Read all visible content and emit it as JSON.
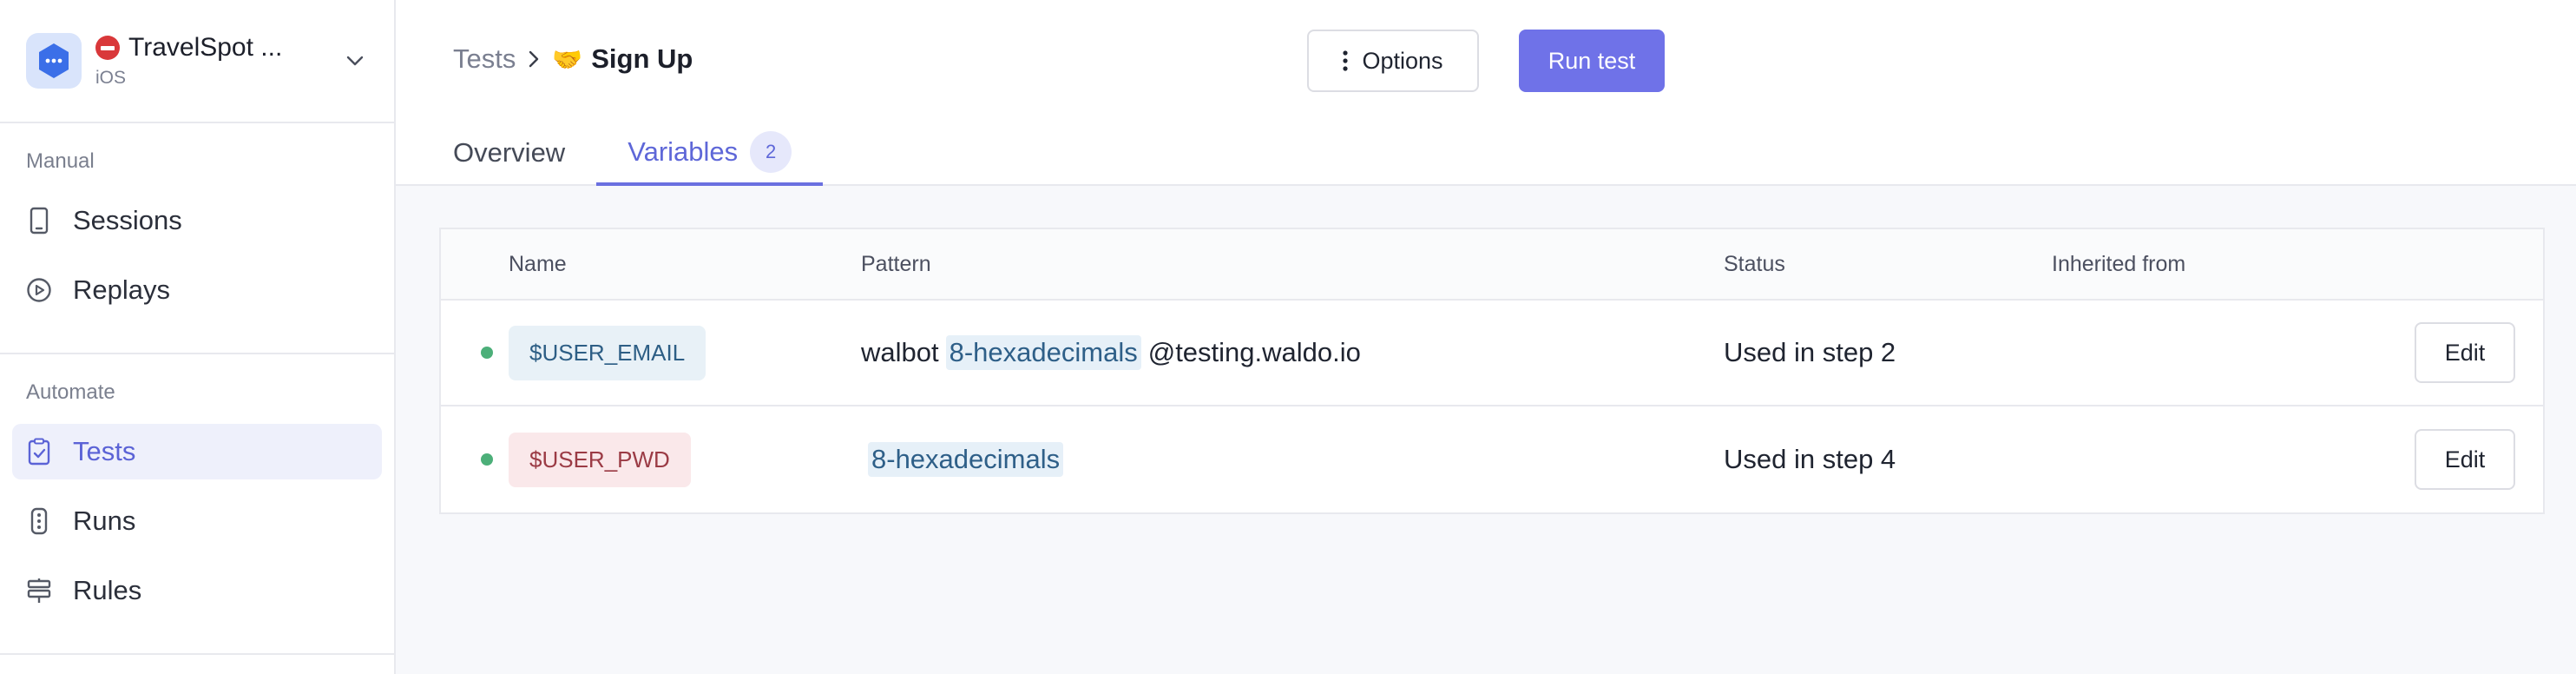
{
  "app": {
    "name": "TravelSpot ...",
    "platform": "iOS"
  },
  "sidebar": {
    "sections": [
      {
        "title": "Manual",
        "items": [
          {
            "label": "Sessions",
            "icon": "phone-icon"
          },
          {
            "label": "Replays",
            "icon": "play-circle-icon"
          }
        ]
      },
      {
        "title": "Automate",
        "items": [
          {
            "label": "Tests",
            "icon": "clipboard-check-icon",
            "active": true
          },
          {
            "label": "Runs",
            "icon": "traffic-light-icon"
          },
          {
            "label": "Rules",
            "icon": "signpost-icon"
          }
        ]
      }
    ]
  },
  "header": {
    "breadcrumb": {
      "parent": "Tests",
      "current": "Sign Up",
      "current_emoji": "🤝"
    },
    "options_label": "Options",
    "run_label": "Run test"
  },
  "tabs": [
    {
      "label": "Overview",
      "active": false
    },
    {
      "label": "Variables",
      "count": "2",
      "active": true
    }
  ],
  "table": {
    "columns": [
      "Name",
      "Pattern",
      "Status",
      "Inherited from"
    ],
    "rows": [
      {
        "name": "$USER_EMAIL",
        "pattern_prefix": "walbot",
        "pattern_tag": "8-hexadecimals",
        "pattern_suffix": "@testing.waldo.io",
        "status": "Used in step 2",
        "inherited": "",
        "action": "Edit"
      },
      {
        "name": "$USER_PWD",
        "pattern_prefix": "",
        "pattern_tag": "8-hexadecimals",
        "pattern_suffix": "",
        "status": "Used in step 4",
        "inherited": "",
        "action": "Edit"
      }
    ]
  },
  "colors": {
    "accent": "#6f72e8",
    "active_text": "#5e67d8",
    "status_dot": "#4caf79"
  }
}
